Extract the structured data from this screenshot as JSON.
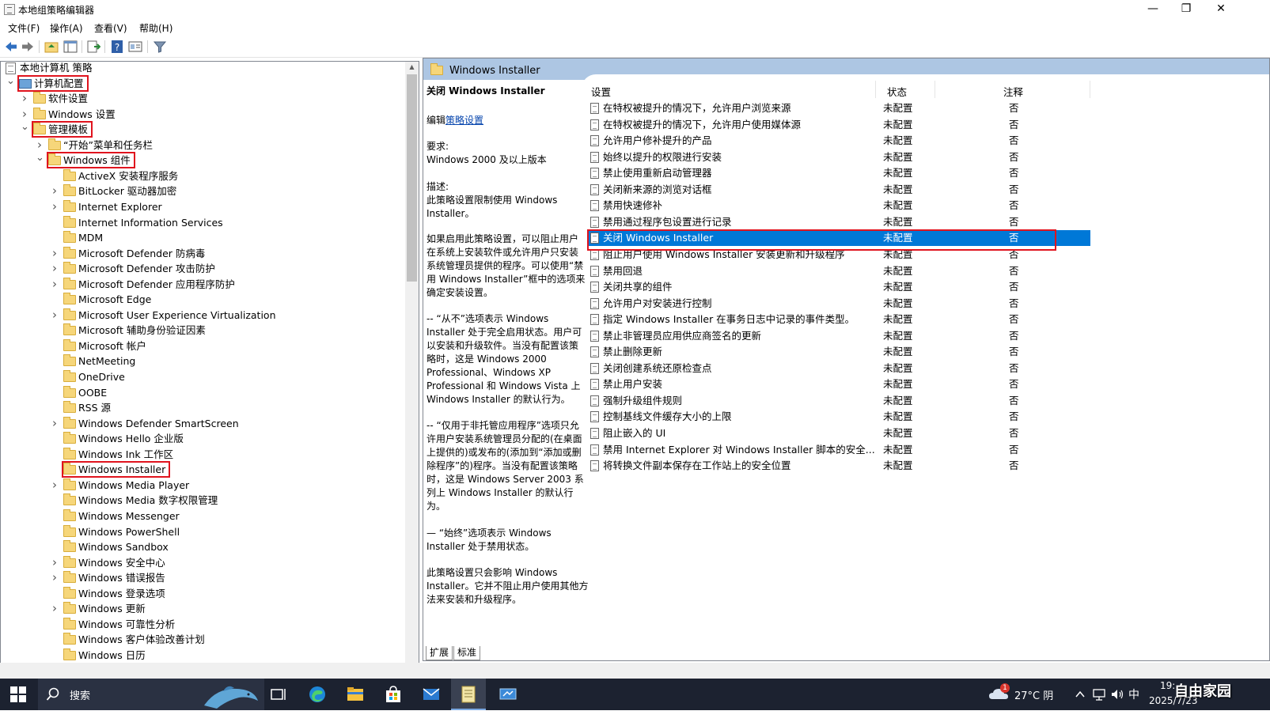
{
  "window": {
    "title": "本地组策略编辑器",
    "controls": {
      "minimize": "—",
      "maximize": "❐",
      "close": "✕"
    }
  },
  "menu": [
    "文件(F)",
    "操作(A)",
    "查看(V)",
    "帮助(H)"
  ],
  "tree": [
    {
      "label": "本地计算机 策略",
      "icon": "doc",
      "level": 0,
      "expander": "",
      "highlight": false
    },
    {
      "label": "计算机配置",
      "icon": "computer",
      "level": 0,
      "expander": "v",
      "highlight": true
    },
    {
      "label": "软件设置",
      "icon": "folder",
      "level": 1,
      "expander": ">",
      "highlight": false
    },
    {
      "label": "Windows 设置",
      "icon": "folder",
      "level": 1,
      "expander": ">",
      "highlight": false
    },
    {
      "label": "管理模板",
      "icon": "folder",
      "level": 1,
      "expander": "v",
      "highlight": true
    },
    {
      "label": "“开始”菜单和任务栏",
      "icon": "folder",
      "level": 2,
      "expander": ">",
      "highlight": false
    },
    {
      "label": "Windows 组件",
      "icon": "folder",
      "level": 2,
      "expander": "v",
      "highlight": true
    },
    {
      "label": "ActiveX 安装程序服务",
      "icon": "folder",
      "level": 3,
      "expander": "",
      "highlight": false
    },
    {
      "label": "BitLocker 驱动器加密",
      "icon": "folder",
      "level": 3,
      "expander": ">",
      "highlight": false
    },
    {
      "label": "Internet Explorer",
      "icon": "folder",
      "level": 3,
      "expander": ">",
      "highlight": false
    },
    {
      "label": "Internet Information Services",
      "icon": "folder",
      "level": 3,
      "expander": "",
      "highlight": false
    },
    {
      "label": "MDM",
      "icon": "folder",
      "level": 3,
      "expander": "",
      "highlight": false
    },
    {
      "label": "Microsoft Defender 防病毒",
      "icon": "folder",
      "level": 3,
      "expander": ">",
      "highlight": false
    },
    {
      "label": "Microsoft Defender 攻击防护",
      "icon": "folder",
      "level": 3,
      "expander": ">",
      "highlight": false
    },
    {
      "label": "Microsoft Defender 应用程序防护",
      "icon": "folder",
      "level": 3,
      "expander": ">",
      "highlight": false
    },
    {
      "label": "Microsoft Edge",
      "icon": "folder",
      "level": 3,
      "expander": "",
      "highlight": false
    },
    {
      "label": "Microsoft User Experience Virtualization",
      "icon": "folder",
      "level": 3,
      "expander": ">",
      "highlight": false
    },
    {
      "label": "Microsoft 辅助身份验证因素",
      "icon": "folder",
      "level": 3,
      "expander": "",
      "highlight": false
    },
    {
      "label": "Microsoft 帐户",
      "icon": "folder",
      "level": 3,
      "expander": "",
      "highlight": false
    },
    {
      "label": "NetMeeting",
      "icon": "folder",
      "level": 3,
      "expander": "",
      "highlight": false
    },
    {
      "label": "OneDrive",
      "icon": "folder",
      "level": 3,
      "expander": "",
      "highlight": false
    },
    {
      "label": "OOBE",
      "icon": "folder",
      "level": 3,
      "expander": "",
      "highlight": false
    },
    {
      "label": "RSS 源",
      "icon": "folder",
      "level": 3,
      "expander": "",
      "highlight": false
    },
    {
      "label": "Windows Defender SmartScreen",
      "icon": "folder",
      "level": 3,
      "expander": ">",
      "highlight": false
    },
    {
      "label": "Windows Hello 企业版",
      "icon": "folder",
      "level": 3,
      "expander": "",
      "highlight": false
    },
    {
      "label": "Windows Ink 工作区",
      "icon": "folder",
      "level": 3,
      "expander": "",
      "highlight": false
    },
    {
      "label": "Windows Installer",
      "icon": "folder",
      "level": 3,
      "expander": "",
      "highlight": true
    },
    {
      "label": "Windows Media Player",
      "icon": "folder",
      "level": 3,
      "expander": ">",
      "highlight": false
    },
    {
      "label": "Windows Media 数字权限管理",
      "icon": "folder",
      "level": 3,
      "expander": "",
      "highlight": false
    },
    {
      "label": "Windows Messenger",
      "icon": "folder",
      "level": 3,
      "expander": "",
      "highlight": false
    },
    {
      "label": "Windows PowerShell",
      "icon": "folder",
      "level": 3,
      "expander": "",
      "highlight": false
    },
    {
      "label": "Windows Sandbox",
      "icon": "folder",
      "level": 3,
      "expander": "",
      "highlight": false
    },
    {
      "label": "Windows 安全中心",
      "icon": "folder",
      "level": 3,
      "expander": ">",
      "highlight": false
    },
    {
      "label": "Windows 错误报告",
      "icon": "folder",
      "level": 3,
      "expander": ">",
      "highlight": false
    },
    {
      "label": "Windows 登录选项",
      "icon": "folder",
      "level": 3,
      "expander": "",
      "highlight": false
    },
    {
      "label": "Windows 更新",
      "icon": "folder",
      "level": 3,
      "expander": ">",
      "highlight": false
    },
    {
      "label": "Windows 可靠性分析",
      "icon": "folder",
      "level": 3,
      "expander": "",
      "highlight": false
    },
    {
      "label": "Windows 客户体验改善计划",
      "icon": "folder",
      "level": 3,
      "expander": "",
      "highlight": false
    },
    {
      "label": "Windows 日历",
      "icon": "folder",
      "level": 3,
      "expander": "",
      "highlight": false
    }
  ],
  "right_pane": {
    "header": "Windows Installer",
    "description": {
      "title": "关闭 Windows Installer",
      "edit_prefix": "编辑",
      "edit_link": "策略设置",
      "lines": [
        "要求:",
        "Windows 2000 及以上版本",
        "描述:",
        "此策略设置限制使用 Windows",
        "Installer。",
        "如果启用此策略设置，可以阻止用户",
        "在系统上安装软件或允许用户只安装",
        "系统管理员提供的程序。可以使用“禁",
        "用 Windows Installer”框中的选项来",
        "确定安装设置。",
        "-- “从不”选项表示 Windows",
        "Installer 处于完全启用状态。用户可",
        "以安装和升级软件。当没有配置该策",
        "略时，这是 Windows 2000",
        "Professional、Windows XP",
        "Professional 和 Windows Vista 上",
        "Windows Installer 的默认行为。",
        "-- “仅用于非托管应用程序”选项只允",
        "许用户安装系统管理员分配的(在桌面",
        "上提供的)或发布的(添加到“添加或删",
        "除程序”的)程序。当没有配置该策略",
        "时，这是 Windows Server 2003 系",
        "列上 Windows Installer 的默认行",
        "为。",
        "— “始终”选项表示 Windows",
        "Installer 处于禁用状态。",
        "此策略设置只会影响 Windows",
        "Installer。它并不阻止用户使用其他方",
        "法来安装和升级程序。"
      ]
    },
    "columns": {
      "setting": "设置",
      "state": "状态",
      "comment": "注释"
    },
    "policies": [
      {
        "name": "在特权被提升的情况下，允许用户浏览来源",
        "state": "未配置",
        "comment": "否"
      },
      {
        "name": "在特权被提升的情况下，允许用户使用媒体源",
        "state": "未配置",
        "comment": "否"
      },
      {
        "name": "允许用户修补提升的产品",
        "state": "未配置",
        "comment": "否"
      },
      {
        "name": "始终以提升的权限进行安装",
        "state": "未配置",
        "comment": "否"
      },
      {
        "name": "禁止使用重新启动管理器",
        "state": "未配置",
        "comment": "否"
      },
      {
        "name": "关闭新来源的浏览对话框",
        "state": "未配置",
        "comment": "否"
      },
      {
        "name": "禁用快速修补",
        "state": "未配置",
        "comment": "否"
      },
      {
        "name": "禁用通过程序包设置进行记录",
        "state": "未配置",
        "comment": "否"
      },
      {
        "name": "关闭 Windows Installer",
        "state": "未配置",
        "comment": "否"
      },
      {
        "name": "阻止用户使用 Windows Installer 安装更新和升级程序",
        "state": "未配置",
        "comment": "否"
      },
      {
        "name": "禁用回退",
        "state": "未配置",
        "comment": "否"
      },
      {
        "name": "关闭共享的组件",
        "state": "未配置",
        "comment": "否"
      },
      {
        "name": "允许用户对安装进行控制",
        "state": "未配置",
        "comment": "否"
      },
      {
        "name": "指定 Windows Installer 在事务日志中记录的事件类型。",
        "state": "未配置",
        "comment": "否"
      },
      {
        "name": "禁止非管理员应用供应商签名的更新",
        "state": "未配置",
        "comment": "否"
      },
      {
        "name": "禁止删除更新",
        "state": "未配置",
        "comment": "否"
      },
      {
        "name": "关闭创建系统还原检查点",
        "state": "未配置",
        "comment": "否"
      },
      {
        "name": "禁止用户安装",
        "state": "未配置",
        "comment": "否"
      },
      {
        "name": "强制升级组件规则",
        "state": "未配置",
        "comment": "否"
      },
      {
        "name": "控制基线文件缓存大小的上限",
        "state": "未配置",
        "comment": "否"
      },
      {
        "name": "阻止嵌入的 UI",
        "state": "未配置",
        "comment": "否"
      },
      {
        "name": "禁用 Internet Explorer 对 Windows Installer 脚本的安全...",
        "state": "未配置",
        "comment": "否"
      },
      {
        "name": "将转换文件副本保存在工作站上的安全位置",
        "state": "未配置",
        "comment": "否"
      }
    ],
    "selected_index": 8,
    "tabs": [
      "扩展",
      "标准"
    ]
  },
  "taskbar": {
    "search_placeholder": "搜索",
    "weather": "27°C 阴",
    "weather_badge": "1",
    "ime": "中",
    "time": "19:",
    "date": "2025/7/23",
    "watermark": "自由家园"
  },
  "colors": {
    "selection": "#0078d7",
    "highlight_box": "#e0141e",
    "header": "#adc6e3",
    "taskbar": "#1c2230"
  }
}
